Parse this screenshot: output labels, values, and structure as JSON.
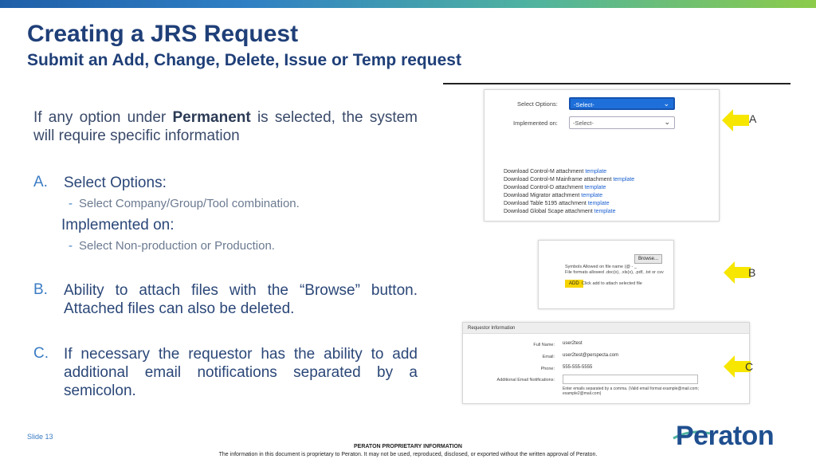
{
  "title": "Creating a JRS Request",
  "subtitle": "Submit an Add, Change, Delete, Issue or Temp request",
  "intro": {
    "prefix": "If any option under ",
    "bold": "Permanent",
    "suffix": " is selected, the system will require specific information"
  },
  "sections": {
    "a": {
      "letter": "A.",
      "heading": "Select Options:",
      "sub1": "Select Company/Group/Tool combination.",
      "heading2": "Implemented on:",
      "sub2": "Select Non-production or Production."
    },
    "b": {
      "letter": "B.",
      "text": "Ability to attach files with the “Browse” button. Attached files can also be deleted."
    },
    "c": {
      "letter": "C.",
      "text": "If necessary the requestor has the ability to add additional email notifications separated by a semicolon."
    }
  },
  "panel_a": {
    "select_options_label": "Select Options:",
    "select_options_value": "-Select-",
    "implemented_on_label": "Implemented on:",
    "implemented_on_value": "-Select-",
    "downloads": [
      {
        "text": "Download Control-M attachment ",
        "link": "template"
      },
      {
        "text": "Download Control-M Mainframe attachment ",
        "link": "template"
      },
      {
        "text": "Download Control-D attachment ",
        "link": "template"
      },
      {
        "text": "Download Migrator attachment ",
        "link": "template"
      },
      {
        "text": "Download Table 5195 attachment ",
        "link": "template"
      },
      {
        "text": "Download Global Scape attachment ",
        "link": "template"
      }
    ]
  },
  "panel_b": {
    "browse_label": "Browse...",
    "symbols_text": "Symbols Allowed on file name (@ - _",
    "formats_text": "File formats allowed .doc(x), .xls(x), .pdf, .txt or csv",
    "add_label": "ADD",
    "add_hint": "Click add to attach selected file"
  },
  "panel_c": {
    "header": "Requestor Information",
    "full_name_label": "Full Name:",
    "full_name_value": "user2test",
    "email_label": "Email:",
    "email_value": "user2test@perspecta.com",
    "phone_label": "Phone:",
    "phone_value": "555-555-5555",
    "additional_label": "Additional Email Notifications:",
    "hint_line1": "Enter emails separated by a comma. (Valid email format example@mail.com;",
    "hint_line2": "example2@mail.com)"
  },
  "arrows": {
    "a": "A",
    "b": "B",
    "c": "C"
  },
  "footer": {
    "slide": "Slide 13",
    "title": "PERATON PROPRIETARY INFORMATION",
    "text": "The information in this document is proprietary to Peraton. It may not be used, reproduced, disclosed, or exported without the written approval of Peraton.",
    "logo": "Peraton"
  },
  "colors": {
    "title": "#1f3f78",
    "accent": "#3b7cc4",
    "arrow": "#f6e600",
    "select_active": "#1e6fd9",
    "link": "#1a5fd0"
  }
}
